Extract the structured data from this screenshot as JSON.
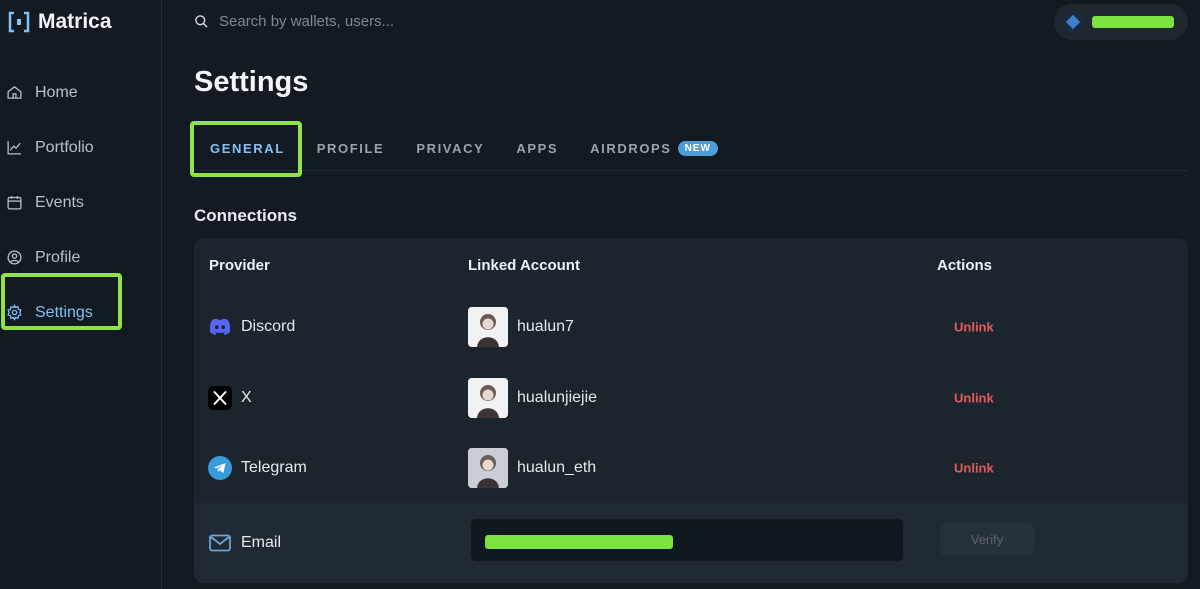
{
  "app": {
    "name": "Matrica"
  },
  "sidebar": {
    "items": [
      {
        "label": "Home",
        "icon": "home-icon"
      },
      {
        "label": "Portfolio",
        "icon": "chart-icon"
      },
      {
        "label": "Events",
        "icon": "calendar-icon"
      },
      {
        "label": "Profile",
        "icon": "user-circle-icon"
      },
      {
        "label": "Settings",
        "icon": "gear-icon",
        "active": true
      }
    ]
  },
  "search": {
    "placeholder": "Search by wallets, users..."
  },
  "page": {
    "title": "Settings"
  },
  "tabs": [
    {
      "label": "GENERAL",
      "active": true
    },
    {
      "label": "PROFILE"
    },
    {
      "label": "PRIVACY"
    },
    {
      "label": "APPS"
    },
    {
      "label": "AIRDROPS",
      "badge": "NEW"
    }
  ],
  "connections": {
    "title": "Connections",
    "headers": {
      "provider": "Provider",
      "linked_account": "Linked Account",
      "actions": "Actions"
    },
    "rows": [
      {
        "provider": "Discord",
        "icon": "discord-icon",
        "account": "hualun7",
        "action": "Unlink"
      },
      {
        "provider": "X",
        "icon": "x-icon",
        "account": "hualunjiejie",
        "action": "Unlink"
      },
      {
        "provider": "Telegram",
        "icon": "telegram-icon",
        "account": "hualun_eth",
        "action": "Unlink"
      }
    ],
    "email": {
      "provider": "Email",
      "icon": "mail-icon",
      "value": "",
      "verify_label": "Verify"
    }
  },
  "colors": {
    "accent": "#7ec2f7",
    "highlight": "#8fe24a",
    "danger": "#e25c5c",
    "background": "#141a21",
    "card": "#1c242d"
  }
}
